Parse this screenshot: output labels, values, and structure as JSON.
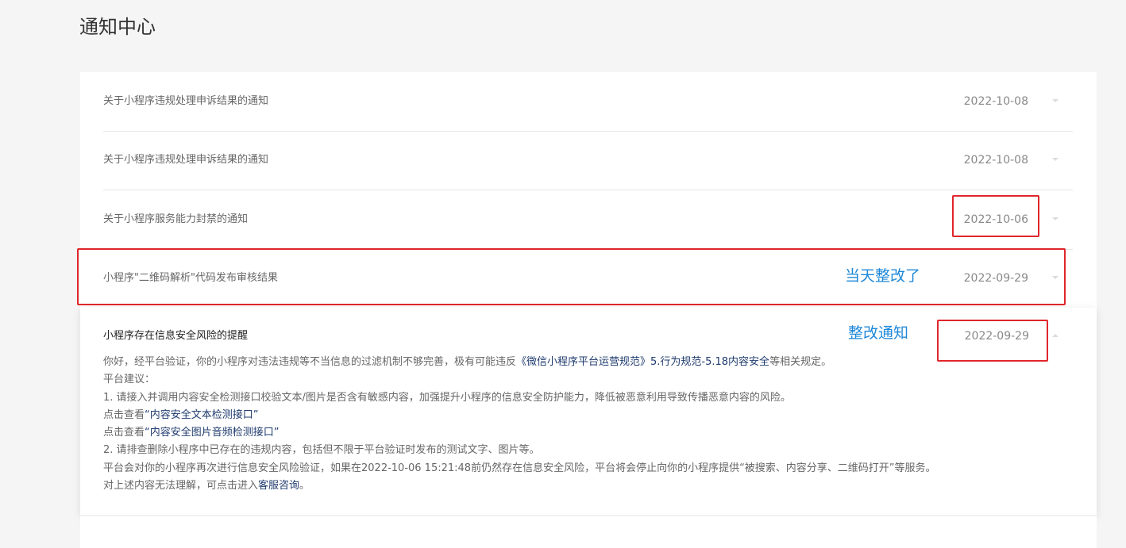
{
  "page": {
    "title": "通知中心"
  },
  "notices": [
    {
      "title": "关于小程序违规处理申诉结果的通知",
      "date": "2022-10-08"
    },
    {
      "title": "关于小程序违规处理申诉结果的通知",
      "date": "2022-10-08"
    },
    {
      "title": "关于小程序服务能力封禁的通知",
      "date": "2022-10-06"
    },
    {
      "title": "小程序\"二维码解析\"代码发布审核结果",
      "date": "2022-09-29"
    }
  ],
  "expanded": {
    "title": "小程序存在信息安全风险的提醒",
    "date": "2022-09-29",
    "line1_pre": "你好，经平台验证，你的小程序对违法违规等不当信息的过滤机制不够完善，极有可能违反",
    "line1_link": "《微信小程序平台运营规范》5.行为规范-5.18内容安全",
    "line1_post": "等相关规定。",
    "line2": "平台建议：",
    "line3": "1. 请接入并调用内容安全检测接口校验文本/图片是否含有敏感内容，加强提升小程序的信息安全防护能力，降低被恶意利用导致传播恶意内容的风险。",
    "line4_pre": "点击查看",
    "line4_link": "“内容安全文本检测接口”",
    "line5_pre": "点击查看",
    "line5_link": "“内容安全图片音频检测接口”",
    "line6": "2. 请排查删除小程序中已存在的违规内容，包括但不限于平台验证时发布的测试文字、图片等。",
    "line7": "平台会对你的小程序再次进行信息安全风险验证，如果在2022-10-06 15:21:48前仍然存在信息安全风险，平台将会停止向你的小程序提供“被搜索、内容分享、二维码打开”等服务。",
    "line8_pre": "对上述内容无法理解，可点击进入",
    "line8_link": "客服咨询",
    "line8_post": "。"
  },
  "annotations": {
    "note1": "当天整改了",
    "note2": "整改通知",
    "box_color": "#e0262b",
    "text_color": "#1e88d8"
  }
}
